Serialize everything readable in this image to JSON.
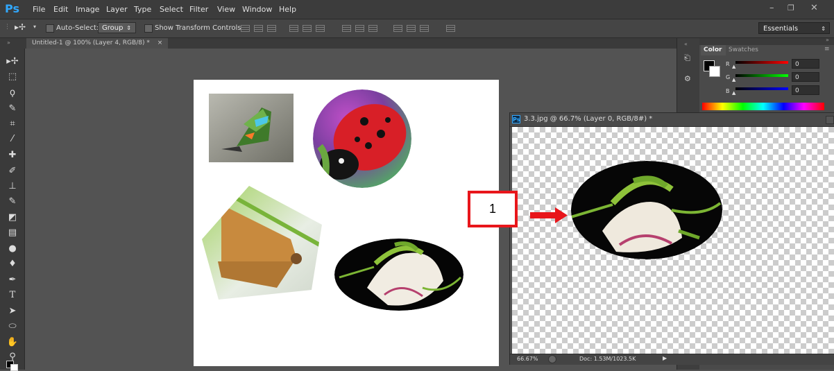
{
  "app": {
    "logo": "Ps",
    "accent": "#31a8ff"
  },
  "menu": [
    "File",
    "Edit",
    "Image",
    "Layer",
    "Type",
    "Select",
    "Filter",
    "View",
    "Window",
    "Help"
  ],
  "options_bar": {
    "auto_select_label": "Auto-Select:",
    "group_value": "Group",
    "show_transform_label": "Show Transform Controls",
    "workspace": "Essentials"
  },
  "document_tab": "Untitled-1 @ 100% (Layer 4, RGB/8) *",
  "color_panel": {
    "tabs": [
      "Color",
      "Swatches"
    ],
    "sliders": [
      {
        "label": "R",
        "value": "0",
        "color": "#d21b1b"
      },
      {
        "label": "G",
        "value": "0",
        "color": "#18c318"
      },
      {
        "label": "B",
        "value": "0",
        "color": "#2020d8"
      }
    ]
  },
  "float_window": {
    "title": "3.3.jpg @ 66.7% (Layer 0, RGB/8#) *",
    "zoom": "66.67%",
    "doc_size": "Doc: 1.53M/1023.5K"
  },
  "annotation": {
    "label": "1",
    "color": "#e8161b"
  }
}
